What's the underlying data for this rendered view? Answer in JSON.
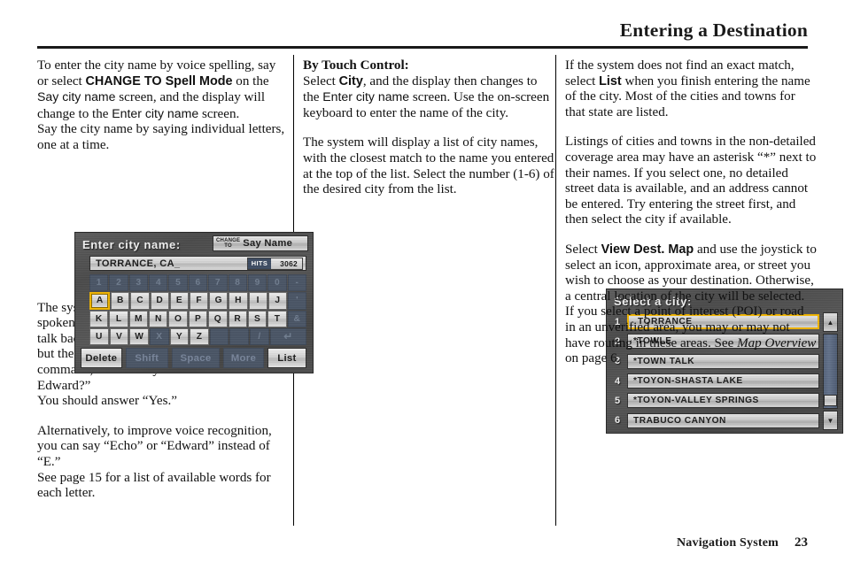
{
  "header": {
    "title": "Entering a Destination"
  },
  "footer": {
    "label": "Navigation System",
    "page": "23"
  },
  "columns": {
    "left": {
      "para1_a": "To enter the city name by voice spelling, say or select ",
      "para1_b_bold": "CHANGE TO Spell Mode",
      "para1_c": " on the ",
      "para1_d_ui": "Say city name",
      "para1_e": " screen, and the display will change to the ",
      "para1_f_ui": "Enter city name",
      "para1_g": " screen.",
      "para2": "Say the city name by saying individual letters, one at a time.",
      "para3": "The system has a talk back function. If your spoken letter is not recognized, the system will talk back to you. For example, if you say “E” but the system does not recognize the command, it will ask you such as “E as in Edward?”",
      "para4": "You should answer “Yes.”",
      "para5": "Alternatively, to improve voice recognition, you can say “Echo” or “Edward” instead of “E.”",
      "para6": "See page 15 for a list of available words for each letter."
    },
    "mid": {
      "heading": "By Touch Control:",
      "para1_a": "Select ",
      "para1_b_bold": "City",
      "para1_c": ", and the display then changes to the ",
      "para1_d_ui": "Enter city name",
      "para1_e": " screen. Use the on-screen keyboard to enter the name of the city.",
      "para2": "The system will display a list of city names, with the closest match to the name you entered at the top of the list. Select the number (1-6) of the desired city from the list."
    },
    "right": {
      "para1_a": "If the system does not find an exact match, select ",
      "para1_b_bold": "List",
      "para1_c": " when you finish entering the name of the city. Most of the cities and towns for that state are listed.",
      "para2": "Listings of cities and towns in the non-detailed coverage area may have an asterisk “*” next to their names. If you select one, no detailed street data is available, and an address cannot be entered. Try entering the street first, and then select the city if available.",
      "para3_a": "Select ",
      "para3_b_bold": "View Dest. Map",
      "para3_c": " and use the joystick to select an icon, approximate area, or street you wish to choose as your destination. Otherwise, a central location of the city will be selected. If you select a point of interest (POI) or road in an unverified area, you may or may not have routing in these areas. See ",
      "para3_d_italic": "Map Overview",
      "para3_e": " on page 6."
    }
  },
  "keyboard_screen": {
    "title": "Enter city name:",
    "change_to_label": "CHANGE\nTO",
    "say_name_label": "Say Name",
    "input_value": "TORRANCE, CA_",
    "hits_label": "HITS",
    "hits_count": "3062",
    "rows": [
      [
        {
          "label": "1",
          "state": "disabled"
        },
        {
          "label": "2",
          "state": "disabled"
        },
        {
          "label": "3",
          "state": "disabled"
        },
        {
          "label": "4",
          "state": "disabled"
        },
        {
          "label": "5",
          "state": "disabled"
        },
        {
          "label": "6",
          "state": "disabled"
        },
        {
          "label": "7",
          "state": "disabled"
        },
        {
          "label": "8",
          "state": "disabled"
        },
        {
          "label": "9",
          "state": "disabled"
        },
        {
          "label": "0",
          "state": "disabled"
        },
        {
          "label": "-",
          "state": "disabled"
        }
      ],
      [
        {
          "label": "A",
          "state": "selected"
        },
        {
          "label": "B",
          "state": "enabled"
        },
        {
          "label": "C",
          "state": "enabled"
        },
        {
          "label": "D",
          "state": "enabled"
        },
        {
          "label": "E",
          "state": "enabled"
        },
        {
          "label": "F",
          "state": "enabled"
        },
        {
          "label": "G",
          "state": "enabled"
        },
        {
          "label": "H",
          "state": "enabled"
        },
        {
          "label": "I",
          "state": "enabled"
        },
        {
          "label": "J",
          "state": "enabled"
        },
        {
          "label": "'",
          "state": "disabled"
        }
      ],
      [
        {
          "label": "K",
          "state": "enabled"
        },
        {
          "label": "L",
          "state": "enabled"
        },
        {
          "label": "M",
          "state": "enabled"
        },
        {
          "label": "N",
          "state": "enabled"
        },
        {
          "label": "O",
          "state": "enabled"
        },
        {
          "label": "P",
          "state": "enabled"
        },
        {
          "label": "Q",
          "state": "enabled"
        },
        {
          "label": "R",
          "state": "enabled"
        },
        {
          "label": "S",
          "state": "enabled"
        },
        {
          "label": "T",
          "state": "enabled"
        },
        {
          "label": "&",
          "state": "disabled"
        }
      ],
      [
        {
          "label": "U",
          "state": "enabled"
        },
        {
          "label": "V",
          "state": "enabled"
        },
        {
          "label": "W",
          "state": "enabled"
        },
        {
          "label": "X",
          "state": "disabled"
        },
        {
          "label": "Y",
          "state": "enabled"
        },
        {
          "label": "Z",
          "state": "enabled"
        },
        {
          "label": "",
          "state": "disabled"
        },
        {
          "label": "",
          "state": "disabled"
        },
        {
          "label": "/",
          "state": "disabled"
        },
        {
          "label": "↵",
          "state": "disabled"
        }
      ]
    ],
    "function_keys": {
      "delete": "Delete",
      "shift": "Shift",
      "space": "Space",
      "more": "More",
      "list": "List"
    }
  },
  "city_list_screen": {
    "title": "Select a city:",
    "items": [
      {
        "num": "1",
        "name": "TORRANCE",
        "state": "selected"
      },
      {
        "num": "2",
        "name": "*TOWLE",
        "state": "normal"
      },
      {
        "num": "3",
        "name": "*TOWN TALK",
        "state": "normal"
      },
      {
        "num": "4",
        "name": "*TOYON-SHASTA LAKE",
        "state": "normal"
      },
      {
        "num": "5",
        "name": "*TOYON-VALLEY SPRINGS",
        "state": "normal"
      },
      {
        "num": "6",
        "name": "TRABUCO CANYON",
        "state": "normal"
      }
    ],
    "scroll_up": "▲",
    "scroll_down": "▼"
  },
  "colors": {
    "highlight": "#f0b400",
    "screen_bg": "#4b4b4b",
    "key_disabled": "#4a5566",
    "hits_badge": "#3d4c62"
  }
}
